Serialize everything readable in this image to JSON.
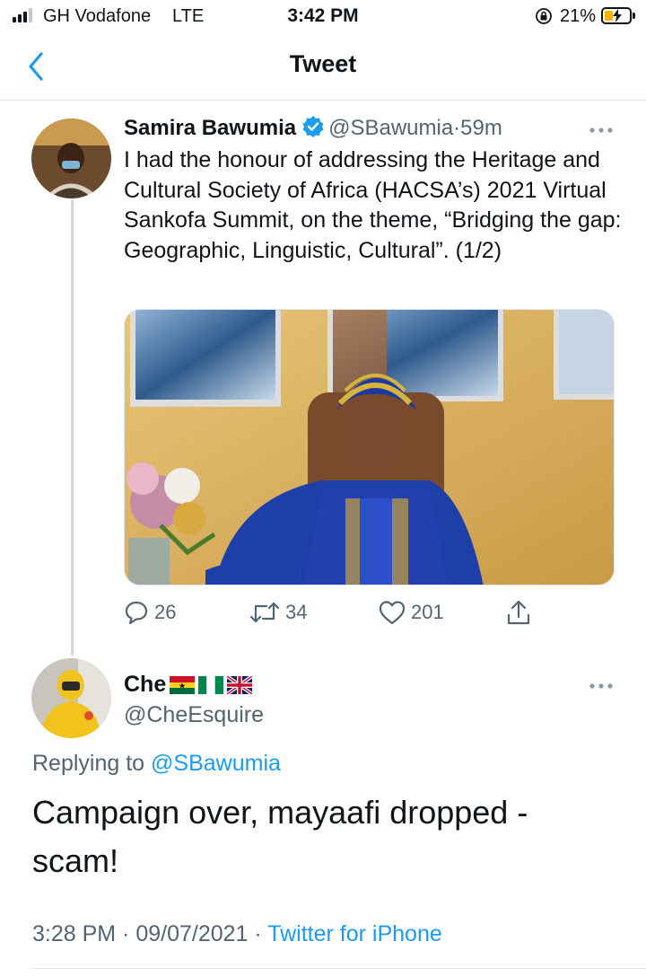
{
  "status_bar": {
    "carrier": "GH Vodafone",
    "network": "LTE",
    "time": "3:42 PM",
    "battery_percent": "21%",
    "battery_level": 0.21,
    "icons": [
      "signal-icon",
      "orientation-lock-icon",
      "battery-charging-icon"
    ]
  },
  "nav": {
    "title": "Tweet",
    "back_icon": "chevron-left-icon"
  },
  "tweet": {
    "author_name": "Samira Bawumia",
    "verified": true,
    "handle": "@SBawumia",
    "separator": "·",
    "time": "59m",
    "text": "I had the honour of addressing the Heritage and Cultural Society of Africa (HACSA’s) 2021 Virtual Sankofa Summit, on the theme, “Bridging the gap: Geographic, Linguistic, Cultural”.  (1/2)",
    "actions": {
      "replies": "26",
      "retweets": "34",
      "likes": "201"
    }
  },
  "reply": {
    "author_name": "Che",
    "flags": [
      "Ghana flag",
      "Nigeria flag",
      "UK flag"
    ],
    "handle": "@CheEsquire",
    "replying_prefix": "Replying to",
    "replying_to": "@SBawumia",
    "text": "Campaign over, mayaafi dropped - scam!",
    "timestamp": "3:28 PM · 09/07/2021",
    "meta_separator": "·",
    "source": "Twitter for iPhone"
  },
  "colors": {
    "accent": "#1d9bf0",
    "secondary_text": "#536471",
    "battery": "#f4b400"
  }
}
